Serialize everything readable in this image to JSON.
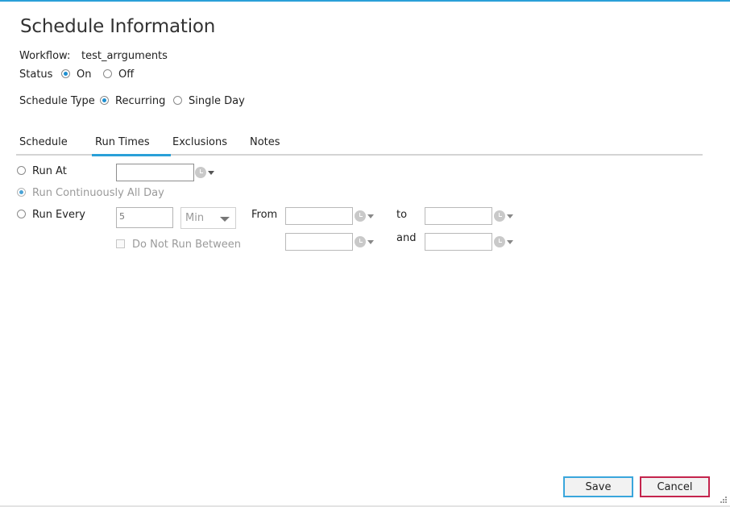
{
  "title": "Schedule Information",
  "workflow": {
    "label": "Workflow:",
    "value": "test_arrguments"
  },
  "status": {
    "label": "Status",
    "options": [
      "On",
      "Off"
    ],
    "selected": "On"
  },
  "schedule_type": {
    "label": "Schedule Type",
    "options": [
      "Recurring",
      "Single Day"
    ],
    "selected": "Recurring"
  },
  "tabs": [
    "Schedule",
    "Run Times",
    "Exclusions",
    "Notes"
  ],
  "active_tab": "Run Times",
  "run_times": {
    "run_at_label": "Run At",
    "run_continuously_label": "Run Continuously All Day",
    "run_every_label": "Run Every",
    "interval_value": "5",
    "interval_unit": "Min",
    "from_label": "From",
    "to_label": "to",
    "and_label": "and",
    "do_not_run_label": "Do Not Run Between",
    "selected_option": "Run Continuously All Day"
  },
  "buttons": {
    "save": "Save",
    "cancel": "Cancel"
  },
  "colors": {
    "accent": "#2aa0d8",
    "cancel_border": "#c4244d"
  },
  "icons": [
    "clock-icon",
    "chevron-down-icon",
    "resize-grip-icon"
  ]
}
